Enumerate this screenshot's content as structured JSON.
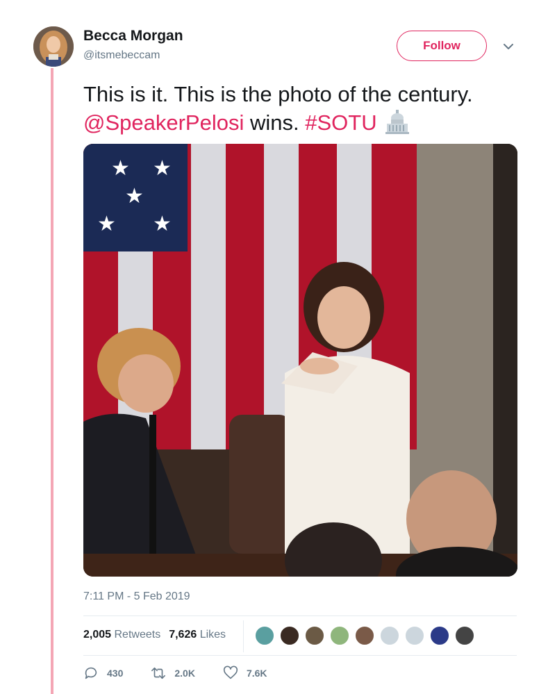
{
  "user": {
    "name": "Becca Morgan",
    "handle": "@itsmebeccam",
    "follow_label": "Follow"
  },
  "tweet": {
    "text_line1": "This is it. This is the photo of the century.",
    "mention": "@SpeakerPelosi",
    "text_mid": " wins. ",
    "hashtag": "#SOTU",
    "emoji": "capitol-building-emoji",
    "timestamp": "7:11 PM - 5 Feb 2019"
  },
  "stats": {
    "retweets_count": "2,005",
    "retweets_label": "Retweets",
    "likes_count": "7,626",
    "likes_label": "Likes"
  },
  "actions": {
    "reply_count": "430",
    "retweet_count": "2.0K",
    "like_count": "7.6K"
  },
  "colors": {
    "accent": "#e0245e",
    "thread_line": "#f4a6b5",
    "muted_text": "#657786"
  },
  "likers": [
    "liker-1",
    "liker-2",
    "liker-3",
    "liker-4",
    "liker-5",
    "liker-6",
    "liker-7",
    "liker-8",
    "liker-9"
  ]
}
